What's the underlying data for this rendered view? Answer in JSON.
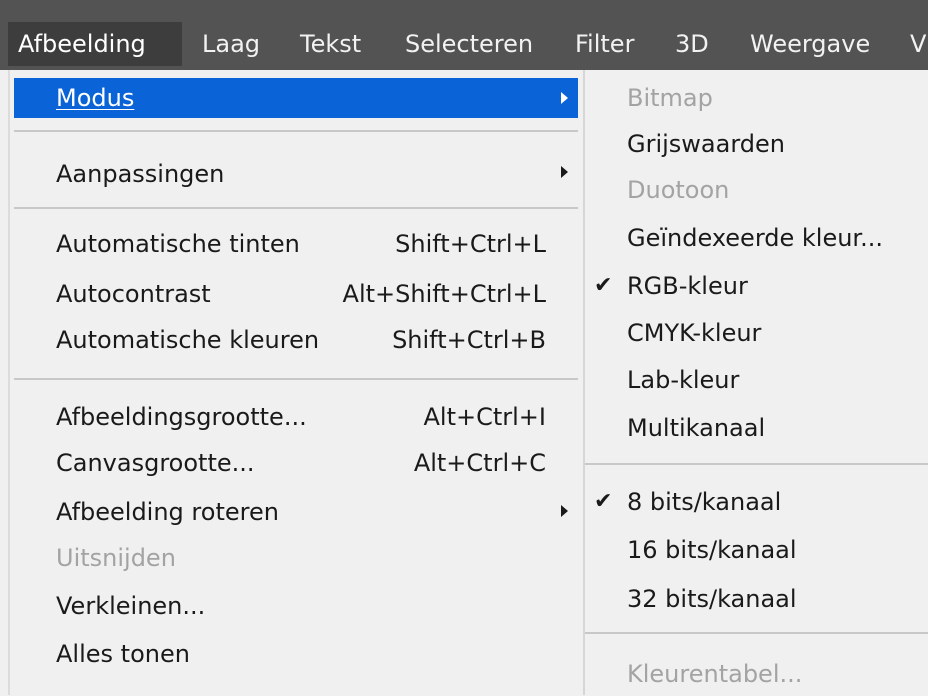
{
  "menubar": {
    "items": [
      {
        "label": "Afbeelding",
        "active": true
      },
      {
        "label": "Laag"
      },
      {
        "label": "Tekst"
      },
      {
        "label": "Selecteren"
      },
      {
        "label": "Filter"
      },
      {
        "label": "3D"
      },
      {
        "label": "Weergave"
      },
      {
        "label": "V"
      }
    ]
  },
  "image_menu": {
    "highlighted": {
      "label": "Modus",
      "has_submenu": true
    },
    "items": [
      {
        "label": "Aanpassingen",
        "has_submenu": true
      },
      {
        "label": "Automatische tinten",
        "shortcut": "Shift+Ctrl+L"
      },
      {
        "label": "Autocontrast",
        "shortcut": "Alt+Shift+Ctrl+L"
      },
      {
        "label": "Automatische kleuren",
        "shortcut": "Shift+Ctrl+B"
      },
      {
        "label": "Afbeeldingsgrootte...",
        "shortcut": "Alt+Ctrl+I"
      },
      {
        "label": "Canvasgrootte...",
        "shortcut": "Alt+Ctrl+C"
      },
      {
        "label": "Afbeelding roteren",
        "has_submenu": true
      },
      {
        "label": "Uitsnijden",
        "disabled": true
      },
      {
        "label": "Verkleinen..."
      },
      {
        "label": "Alles tonen"
      }
    ]
  },
  "mode_submenu": {
    "items": [
      {
        "label": "Bitmap",
        "disabled": true
      },
      {
        "label": "Grijswaarden"
      },
      {
        "label": "Duotoon",
        "disabled": true
      },
      {
        "label": "Geïndexeerde kleur..."
      },
      {
        "label": "RGB-kleur",
        "checked": true
      },
      {
        "label": "CMYK-kleur"
      },
      {
        "label": "Lab-kleur"
      },
      {
        "label": "Multikanaal"
      },
      {
        "label": "8 bits/kanaal",
        "checked": true
      },
      {
        "label": "16 bits/kanaal"
      },
      {
        "label": "32 bits/kanaal"
      },
      {
        "label": "Kleurentabel...",
        "disabled": true
      }
    ],
    "check_glyph": "✔"
  },
  "colors": {
    "menubar_bg": "#535353",
    "highlight": "#0a64d7",
    "menu_bg": "#f0f0f0",
    "disabled_text": "#a3a3a3"
  }
}
